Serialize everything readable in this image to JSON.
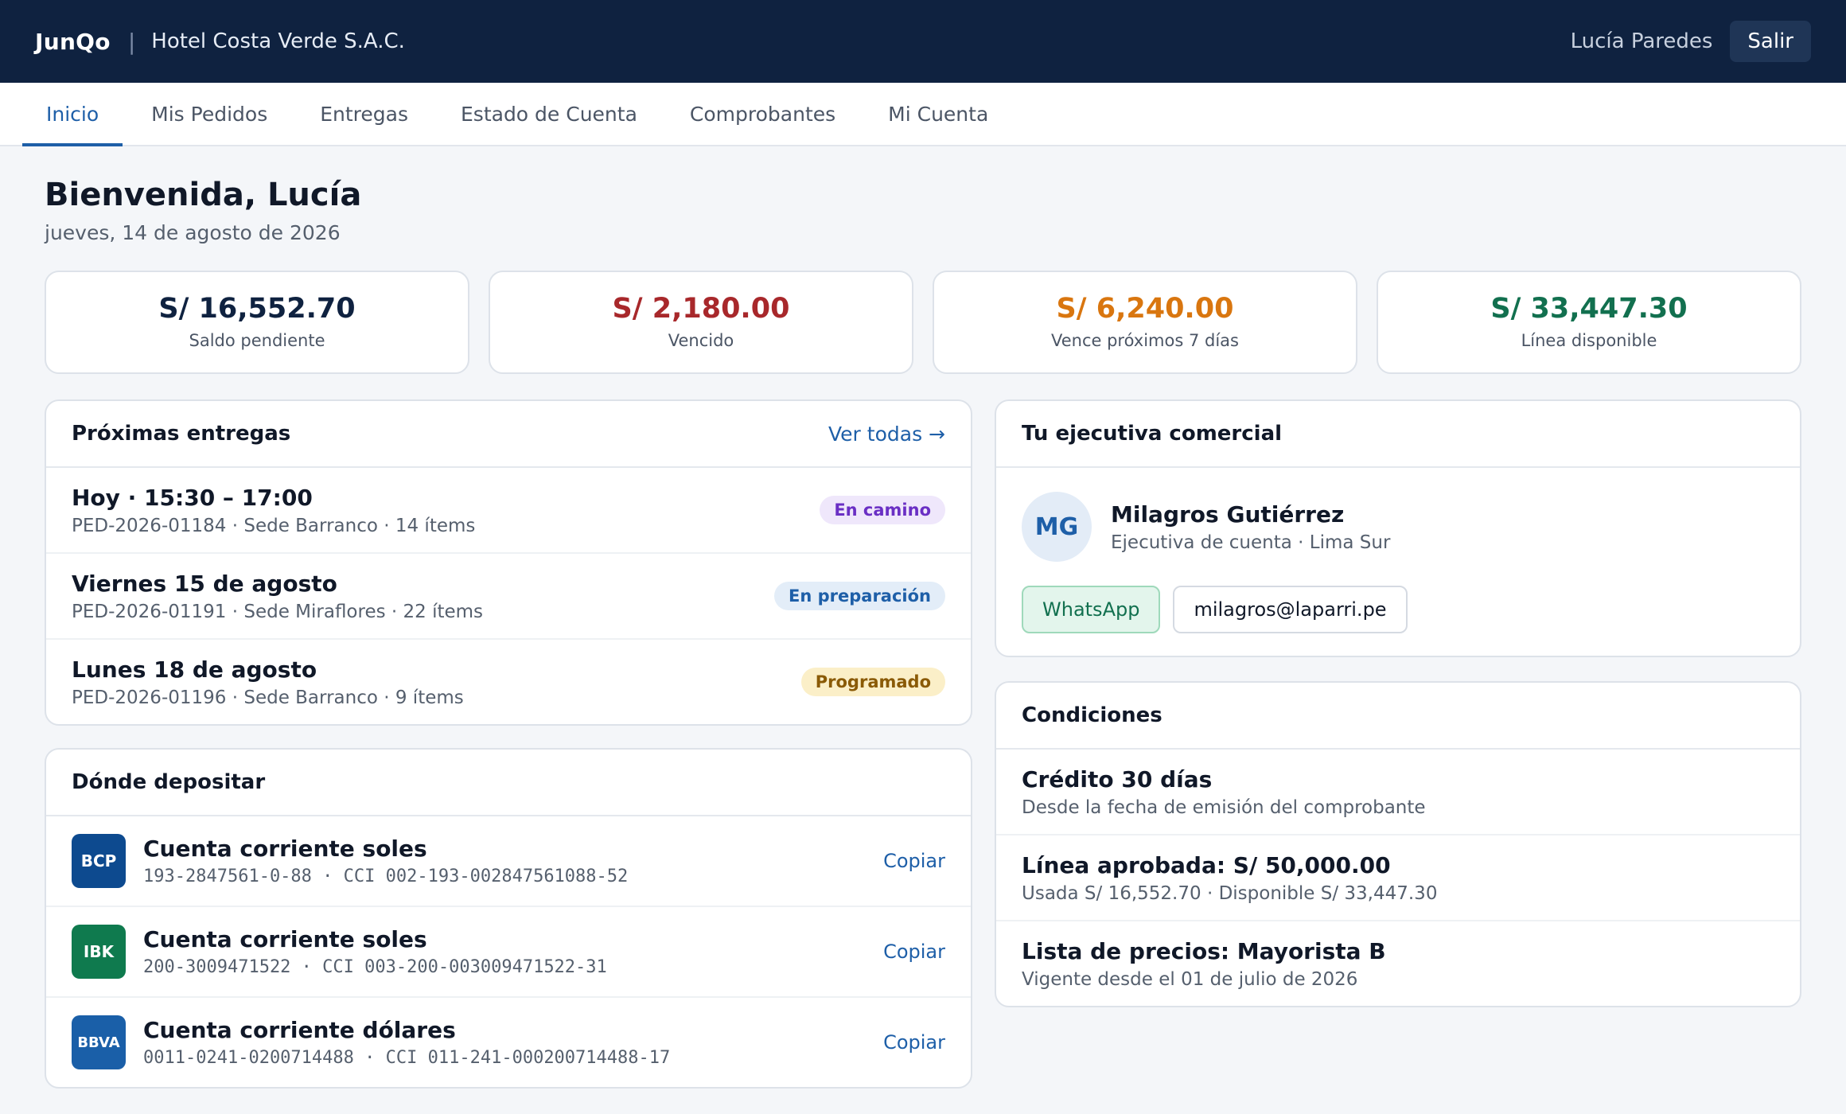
{
  "header": {
    "brand": "JunQo",
    "separator": "|",
    "company": "Hotel Costa Verde S.A.C.",
    "user": "Lucía Paredes",
    "logout": "Salir"
  },
  "nav": {
    "tabs": [
      {
        "label": "Inicio",
        "active": true
      },
      {
        "label": "Mis Pedidos"
      },
      {
        "label": "Entregas"
      },
      {
        "label": "Estado de Cuenta"
      },
      {
        "label": "Comprobantes"
      },
      {
        "label": "Mi Cuenta"
      }
    ]
  },
  "welcome": {
    "title": "Bienvenida, Lucía",
    "date": "jueves, 14 de agosto de 2026"
  },
  "stats": [
    {
      "value": "S/ 16,552.70",
      "label": "Saldo pendiente",
      "color": "#0f2240"
    },
    {
      "value": "S/ 2,180.00",
      "label": "Vencido",
      "color": "#a8282b"
    },
    {
      "value": "S/ 6,240.00",
      "label": "Vence próximos 7 días",
      "color": "#d9760f"
    },
    {
      "value": "S/ 33,447.30",
      "label": "Línea disponible",
      "color": "#12704f"
    }
  ],
  "deliveries": {
    "title": "Próximas entregas",
    "link": "Ver todas →",
    "items": [
      {
        "when": "Hoy · 15:30 – 17:00",
        "detail": "PED-2026-01184 · Sede Barranco · 14 ítems",
        "status": "En camino",
        "status_bg": "#efe7fb",
        "status_color": "#6a2fc4"
      },
      {
        "when": "Viernes 15 de agosto",
        "detail": "PED-2026-01191 · Sede Miraflores · 22 ítems",
        "status": "En preparación",
        "status_bg": "#e3edf8",
        "status_color": "#1e5fa8"
      },
      {
        "when": "Lunes 18 de agosto",
        "detail": "PED-2026-01196 · Sede Barranco · 9 ítems",
        "status": "Programado",
        "status_bg": "#fbefc8",
        "status_color": "#8a5a06"
      }
    ]
  },
  "deposit": {
    "title": "Dónde depositar",
    "copy": "Copiar",
    "accounts": [
      {
        "bank": "BCP",
        "bank_color": "#0d4a8f",
        "type": "Cuenta corriente soles",
        "number": "193-2847561-0-88 · CCI 002-193-002847561088-52"
      },
      {
        "bank": "IBK",
        "bank_color": "#0f7a4e",
        "type": "Cuenta corriente soles",
        "number": "200-3009471522 · CCI 003-200-003009471522-31"
      },
      {
        "bank": "BBVA",
        "bank_color": "#1a5fa8",
        "type": "Cuenta corriente dólares",
        "number": "0011-0241-0200714488 · CCI 011-241-000200714488-17"
      }
    ]
  },
  "executive": {
    "title": "Tu ejecutiva comercial",
    "initials": "MG",
    "name": "Milagros Gutiérrez",
    "role": "Ejecutiva de cuenta · Lima Sur",
    "whatsapp": "WhatsApp",
    "email": "milagros@laparri.pe"
  },
  "conditions": {
    "title": "Condiciones",
    "items": [
      {
        "title": "Crédito 30 días",
        "sub": "Desde la fecha de emisión del comprobante"
      },
      {
        "title": "Línea aprobada: S/ 50,000.00",
        "sub": "Usada S/ 16,552.70 · Disponible S/ 33,447.30"
      },
      {
        "title": "Lista de precios: Mayorista B",
        "sub": "Vigente desde el 01 de julio de 2026"
      }
    ]
  }
}
